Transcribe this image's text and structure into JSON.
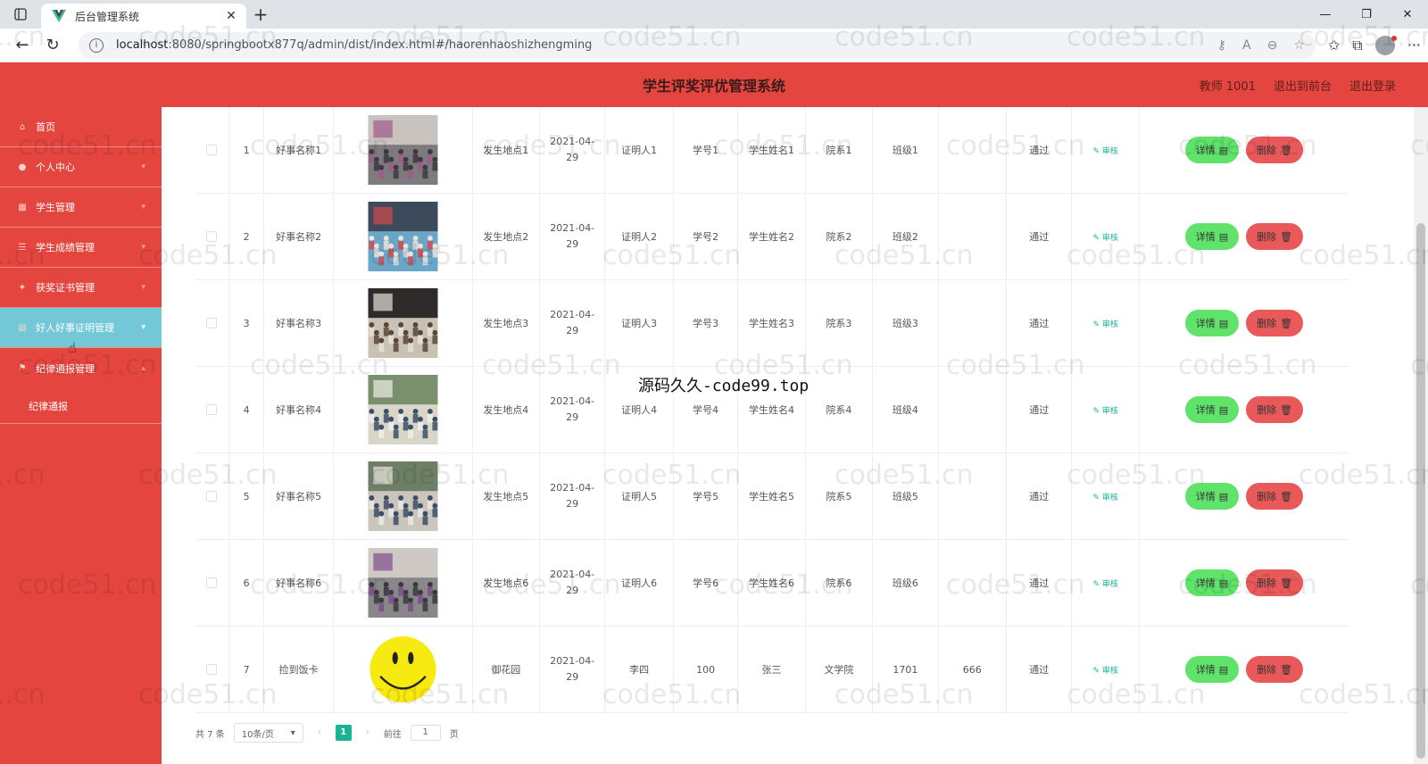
{
  "browser": {
    "tab_title": "后台管理系统",
    "url_host": "localhost",
    "url_rest": ":8080/springbootx877q/admin/dist/index.html#/haorenhaoshizhengming"
  },
  "header": {
    "title": "学生评奖评优管理系统",
    "user": "教师 1001",
    "front_link": "退出到前台",
    "logout_link": "退出登录"
  },
  "sidebar": {
    "items": [
      {
        "label": "首页",
        "icon": "home-icon"
      },
      {
        "label": "个人中心",
        "icon": "user-icon"
      },
      {
        "label": "学生管理",
        "icon": "grid-icon"
      },
      {
        "label": "学生成绩管理",
        "icon": "list-icon"
      },
      {
        "label": "获奖证书管理",
        "icon": "award-icon"
      },
      {
        "label": "好人好事证明管理",
        "icon": "document-icon"
      },
      {
        "label": "纪律通报管理",
        "icon": "flag-icon"
      }
    ],
    "sub_item": "纪律通报"
  },
  "table": {
    "rows": [
      {
        "idx": "1",
        "name": "好事名称1",
        "place": "发生地点1",
        "date": "2021-04-29",
        "witness": "证明人1",
        "sno": "学号1",
        "sname": "学生姓名1",
        "dept": "院系1",
        "cls": "班级1",
        "note": "",
        "status": "通过"
      },
      {
        "idx": "2",
        "name": "好事名称2",
        "place": "发生地点2",
        "date": "2021-04-29",
        "witness": "证明人2",
        "sno": "学号2",
        "sname": "学生姓名2",
        "dept": "院系2",
        "cls": "班级2",
        "note": "",
        "status": "通过"
      },
      {
        "idx": "3",
        "name": "好事名称3",
        "place": "发生地点3",
        "date": "2021-04-29",
        "witness": "证明人3",
        "sno": "学号3",
        "sname": "学生姓名3",
        "dept": "院系3",
        "cls": "班级3",
        "note": "",
        "status": "通过"
      },
      {
        "idx": "4",
        "name": "好事名称4",
        "place": "发生地点4",
        "date": "2021-04-29",
        "witness": "证明人4",
        "sno": "学号4",
        "sname": "学生姓名4",
        "dept": "院系4",
        "cls": "班级4",
        "note": "",
        "status": "通过"
      },
      {
        "idx": "5",
        "name": "好事名称5",
        "place": "发生地点5",
        "date": "2021-04-29",
        "witness": "证明人5",
        "sno": "学号5",
        "sname": "学生姓名5",
        "dept": "院系5",
        "cls": "班级5",
        "note": "",
        "status": "通过"
      },
      {
        "idx": "6",
        "name": "好事名称6",
        "place": "发生地点6",
        "date": "2021-04-29",
        "witness": "证明人6",
        "sno": "学号6",
        "sname": "学生姓名6",
        "dept": "院系6",
        "cls": "班级6",
        "note": "",
        "status": "通过"
      },
      {
        "idx": "7",
        "name": "捡到饭卡",
        "place": "御花园",
        "date": "2021-04-29",
        "witness": "李四",
        "sno": "100",
        "sname": "张三",
        "dept": "文学院",
        "cls": "1701",
        "note": "666",
        "status": "通过"
      }
    ],
    "audit_label": "审核",
    "detail_label": "详情",
    "delete_label": "删除"
  },
  "pager": {
    "total": "共 7 条",
    "size": "10条/页",
    "current": "1",
    "goto_prefix": "前往",
    "goto_value": "1",
    "goto_suffix": "页"
  },
  "overlay_text": "源码久久-code99.top",
  "watermark": "code51.cn",
  "colors": {
    "brand": "#e4463f",
    "active_menu": "#72c8d6",
    "detail": "#5fe36b",
    "delete": "#e95959",
    "accent": "#1ab394"
  }
}
